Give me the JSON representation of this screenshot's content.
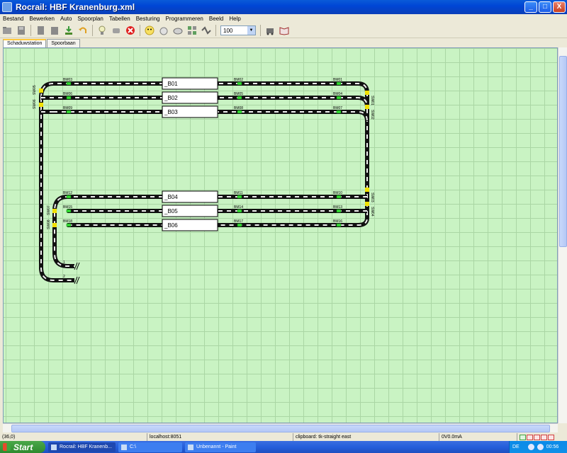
{
  "window": {
    "title": "Rocrail: HBF Kranenburg.xml",
    "minimize": "_",
    "maximize": "□",
    "close": "X"
  },
  "menu": [
    "Bestand",
    "Bewerken",
    "Auto",
    "Spoorplan",
    "Tabellen",
    "Besturing",
    "Programmeren",
    "Beeld",
    "Help"
  ],
  "toolbar": {
    "icons": [
      "open-icon",
      "save-icon",
      "copy-icon",
      "paste-icon",
      "download-icon",
      "undo-icon",
      "lamp-icon",
      "power-icon",
      "emergency-stop-icon",
      "smiley-icon",
      "mouse-icon",
      "magnify-icon",
      "grid-icon",
      "route-icon",
      "train-icon",
      "book-icon"
    ],
    "zoom": "100"
  },
  "tabs": [
    "Schaduwstation",
    "Spoorbaan"
  ],
  "layout": {
    "blocks": [
      "_B01",
      "_B02",
      "_B03",
      "_B04",
      "_B05",
      "_B06"
    ],
    "sensors": {
      "row1": [
        "BM03",
        "BM02",
        "BM01"
      ],
      "row2": [
        "BM06",
        "BM05",
        "BM04"
      ],
      "row3": [
        "BM09",
        "BM08",
        "BM07"
      ],
      "row4": [
        "BM12",
        "BM11",
        "BM10"
      ],
      "row5": [
        "BM15",
        "BM14",
        "BM13"
      ],
      "row6": [
        "BM18",
        "BM17",
        "BM16"
      ]
    },
    "switches_left": [
      "SW05",
      "SW06"
    ],
    "switches_right": [
      "SW01",
      "SW02",
      "SW03",
      "SW04"
    ],
    "switches_lower_left": [
      "SW07",
      "SW08"
    ],
    "buffers": [
      "1",
      "2"
    ],
    "colors": {
      "rail": "#111111",
      "sleeper": "#f0f0f0",
      "sensor_on": "#33dd33",
      "switch": "#f0e000",
      "grid_bg": "#c9f3c3"
    }
  },
  "status": {
    "position": "(36,0)",
    "host": "localhost:8051",
    "clipboard": "clipboard: tk-straight east",
    "power": "0V0.0mA"
  },
  "taskbar": {
    "start": "Start",
    "tasks": [
      "Rocrail: HBF Kranenb...",
      "C:\\",
      "Unbenannt - Paint"
    ],
    "lang": "DE",
    "clock": "00:56"
  }
}
